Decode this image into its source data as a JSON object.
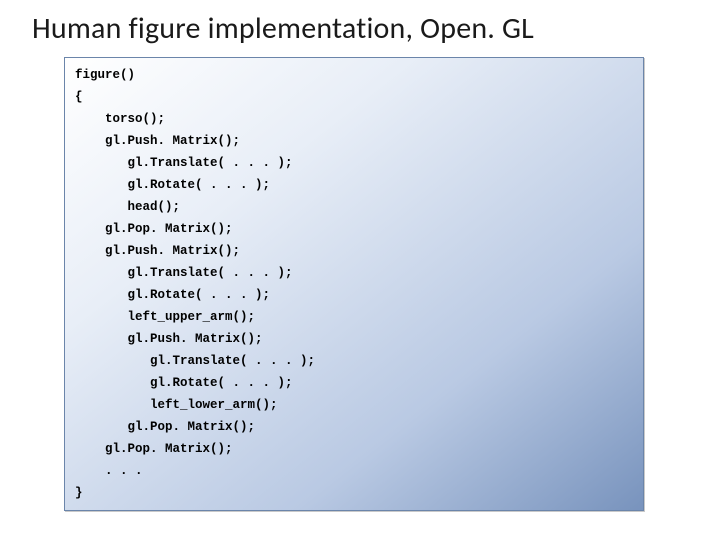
{
  "title": "Human figure implementation, Open. GL",
  "code": {
    "l0": "figure()",
    "l1": "{",
    "l2": "    torso();",
    "l3": "    gl.Push. Matrix();",
    "l4": "       gl.Translate( . . . );",
    "l5": "       gl.Rotate( . . . );",
    "l6": "       head();",
    "l7": "    gl.Pop. Matrix();",
    "l8": "    gl.Push. Matrix();",
    "l9": "       gl.Translate( . . . );",
    "l10": "       gl.Rotate( . . . );",
    "l11": "       left_upper_arm();",
    "l12": "       gl.Push. Matrix();",
    "l13": "          gl.Translate( . . . );",
    "l14": "          gl.Rotate( . . . );",
    "l15": "          left_lower_arm();",
    "l16": "       gl.Pop. Matrix();",
    "l17": "    gl.Pop. Matrix();",
    "l18": "    . . .",
    "l19": "}"
  }
}
